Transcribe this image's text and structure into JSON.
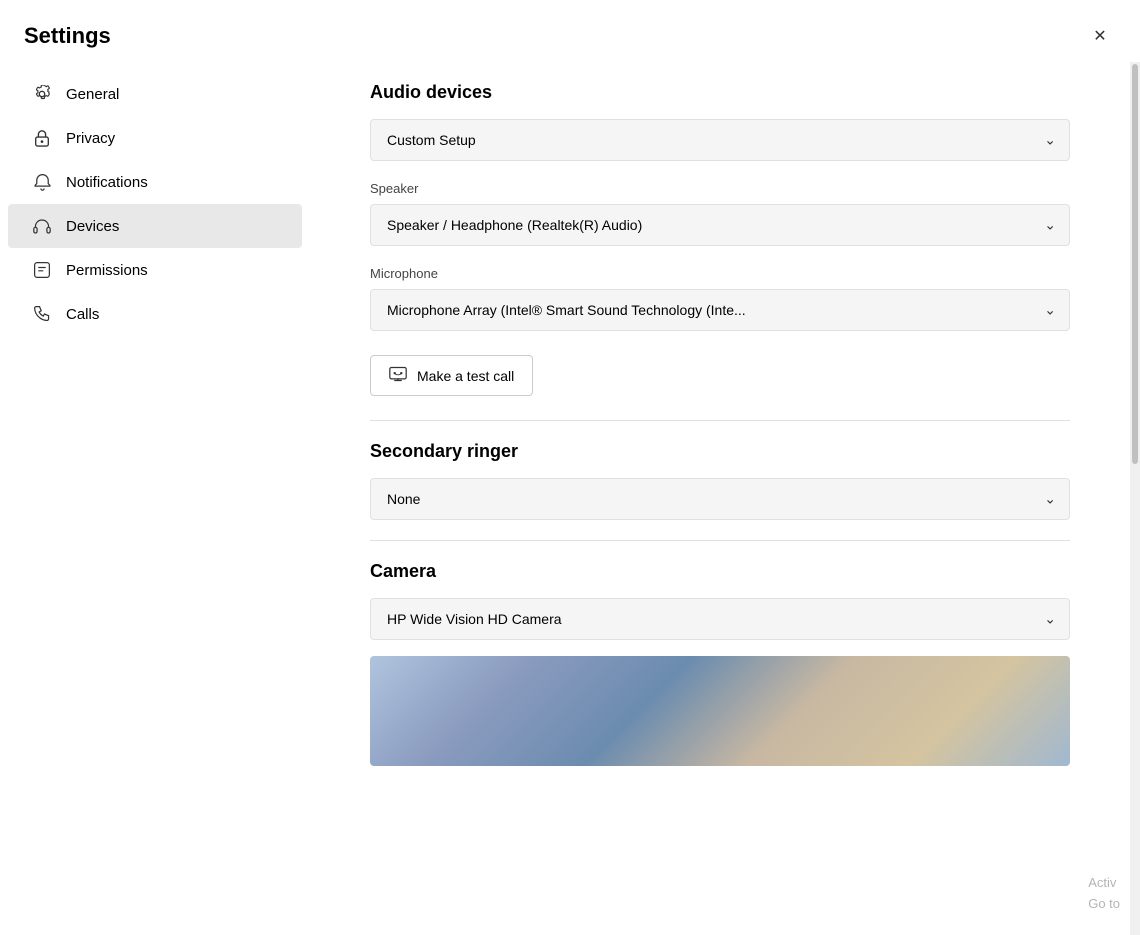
{
  "window": {
    "title": "Settings",
    "close_label": "✕"
  },
  "sidebar": {
    "items": [
      {
        "id": "general",
        "label": "General",
        "icon": "⚙",
        "active": false
      },
      {
        "id": "privacy",
        "label": "Privacy",
        "icon": "🔒",
        "active": false
      },
      {
        "id": "notifications",
        "label": "Notifications",
        "icon": "🔔",
        "active": false
      },
      {
        "id": "devices",
        "label": "Devices",
        "icon": "🎧",
        "active": true
      },
      {
        "id": "permissions",
        "label": "Permissions",
        "icon": "🏷",
        "active": false
      },
      {
        "id": "calls",
        "label": "Calls",
        "icon": "📞",
        "active": false
      }
    ]
  },
  "main": {
    "audio_devices_label": "Audio devices",
    "audio_device_value": "Custom Setup",
    "speaker_label": "Speaker",
    "speaker_value": "Speaker / Headphone (Realtek(R) Audio)",
    "microphone_label": "Microphone",
    "microphone_value": "Microphone Array (Intel® Smart Sound Technology (Inte...",
    "test_call_button": "Make a test call",
    "secondary_ringer_label": "Secondary ringer",
    "secondary_ringer_value": "None",
    "camera_label": "Camera",
    "camera_value": "HP Wide Vision HD Camera",
    "watermark_line1": "Activ",
    "watermark_line2": "Go to"
  }
}
